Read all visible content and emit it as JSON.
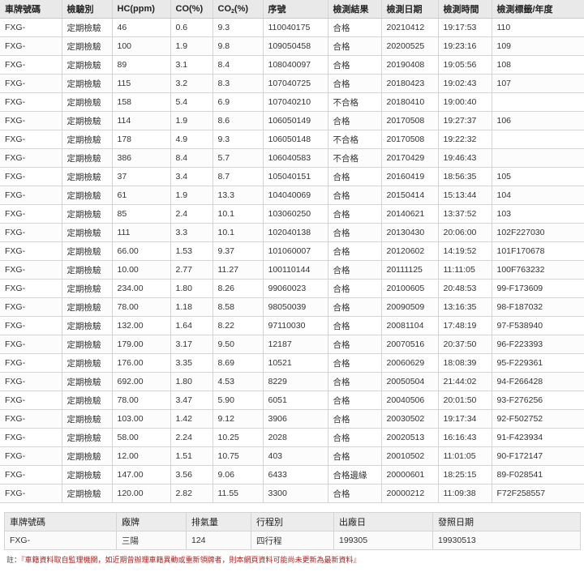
{
  "inspection_table": {
    "headers": {
      "plate": "車牌號碼",
      "category": "檢驗別",
      "hc": "HC(ppm)",
      "co": "CO(%)",
      "co2_prefix": "CO",
      "co2_sub": "2",
      "co2_suffix": "(%)",
      "serial": "序號",
      "result": "檢測結果",
      "date": "檢測日期",
      "time": "檢測時間",
      "label_year": "檢測標籤/年度"
    },
    "rows": [
      {
        "plate": "FXG-",
        "category": "定期檢驗",
        "hc": "46",
        "co": "0.6",
        "co2": "9.3",
        "serial": "110040175",
        "result": "合格",
        "date": "20210412",
        "time": "19:17:53",
        "label": "110"
      },
      {
        "plate": "FXG-",
        "category": "定期檢驗",
        "hc": "100",
        "co": "1.9",
        "co2": "9.8",
        "serial": "109050458",
        "result": "合格",
        "date": "20200525",
        "time": "19:23:16",
        "label": "109"
      },
      {
        "plate": "FXG-",
        "category": "定期檢驗",
        "hc": "89",
        "co": "3.1",
        "co2": "8.4",
        "serial": "108040097",
        "result": "合格",
        "date": "20190408",
        "time": "19:05:56",
        "label": "108"
      },
      {
        "plate": "FXG-",
        "category": "定期檢驗",
        "hc": "115",
        "co": "3.2",
        "co2": "8.3",
        "serial": "107040725",
        "result": "合格",
        "date": "20180423",
        "time": "19:02:43",
        "label": "107"
      },
      {
        "plate": "FXG-",
        "category": "定期檢驗",
        "hc": "158",
        "co": "5.4",
        "co2": "6.9",
        "serial": "107040210",
        "result": "不合格",
        "date": "20180410",
        "time": "19:00:40",
        "label": ""
      },
      {
        "plate": "FXG-",
        "category": "定期檢驗",
        "hc": "114",
        "co": "1.9",
        "co2": "8.6",
        "serial": "106050149",
        "result": "合格",
        "date": "20170508",
        "time": "19:27:37",
        "label": "106"
      },
      {
        "plate": "FXG-",
        "category": "定期檢驗",
        "hc": "178",
        "co": "4.9",
        "co2": "9.3",
        "serial": "106050148",
        "result": "不合格",
        "date": "20170508",
        "time": "19:22:32",
        "label": ""
      },
      {
        "plate": "FXG-",
        "category": "定期檢驗",
        "hc": "386",
        "co": "8.4",
        "co2": "5.7",
        "serial": "106040583",
        "result": "不合格",
        "date": "20170429",
        "time": "19:46:43",
        "label": ""
      },
      {
        "plate": "FXG-",
        "category": "定期檢驗",
        "hc": "37",
        "co": "3.4",
        "co2": "8.7",
        "serial": "105040151",
        "result": "合格",
        "date": "20160419",
        "time": "18:56:35",
        "label": "105"
      },
      {
        "plate": "FXG-",
        "category": "定期檢驗",
        "hc": "61",
        "co": "1.9",
        "co2": "13.3",
        "serial": "104040069",
        "result": "合格",
        "date": "20150414",
        "time": "15:13:44",
        "label": "104"
      },
      {
        "plate": "FXG-",
        "category": "定期檢驗",
        "hc": "85",
        "co": "2.4",
        "co2": "10.1",
        "serial": "103060250",
        "result": "合格",
        "date": "20140621",
        "time": "13:37:52",
        "label": "103"
      },
      {
        "plate": "FXG-",
        "category": "定期檢驗",
        "hc": "111",
        "co": "3.3",
        "co2": "10.1",
        "serial": "102040138",
        "result": "合格",
        "date": "20130430",
        "time": "20:06:00",
        "label": "102F227030"
      },
      {
        "plate": "FXG-",
        "category": "定期檢驗",
        "hc": "66.00",
        "co": "1.53",
        "co2": "9.37",
        "serial": "101060007",
        "result": "合格",
        "date": "20120602",
        "time": "14:19:52",
        "label": "101F170678"
      },
      {
        "plate": "FXG-",
        "category": "定期檢驗",
        "hc": "10.00",
        "co": "2.77",
        "co2": "11.27",
        "serial": "100110144",
        "result": "合格",
        "date": "20111125",
        "time": "11:11:05",
        "label": "100F763232"
      },
      {
        "plate": "FXG-",
        "category": "定期檢驗",
        "hc": "234.00",
        "co": "1.80",
        "co2": "8.26",
        "serial": "99060023",
        "result": "合格",
        "date": "20100605",
        "time": "20:48:53",
        "label": "99-F173609"
      },
      {
        "plate": "FXG-",
        "category": "定期檢驗",
        "hc": "78.00",
        "co": "1.18",
        "co2": "8.58",
        "serial": "98050039",
        "result": "合格",
        "date": "20090509",
        "time": "13:16:35",
        "label": "98-F187032"
      },
      {
        "plate": "FXG-",
        "category": "定期檢驗",
        "hc": "132.00",
        "co": "1.64",
        "co2": "8.22",
        "serial": "97110030",
        "result": "合格",
        "date": "20081104",
        "time": "17:48:19",
        "label": "97-F538940"
      },
      {
        "plate": "FXG-",
        "category": "定期檢驗",
        "hc": "179.00",
        "co": "3.17",
        "co2": "9.50",
        "serial": "12187",
        "result": "合格",
        "date": "20070516",
        "time": "20:37:50",
        "label": "96-F223393"
      },
      {
        "plate": "FXG-",
        "category": "定期檢驗",
        "hc": "176.00",
        "co": "3.35",
        "co2": "8.69",
        "serial": "10521",
        "result": "合格",
        "date": "20060629",
        "time": "18:08:39",
        "label": "95-F229361"
      },
      {
        "plate": "FXG-",
        "category": "定期檢驗",
        "hc": "692.00",
        "co": "1.80",
        "co2": "4.53",
        "serial": "8229",
        "result": "合格",
        "date": "20050504",
        "time": "21:44:02",
        "label": "94-F266428"
      },
      {
        "plate": "FXG-",
        "category": "定期檢驗",
        "hc": "78.00",
        "co": "3.47",
        "co2": "5.90",
        "serial": "6051",
        "result": "合格",
        "date": "20040506",
        "time": "20:01:50",
        "label": "93-F276256"
      },
      {
        "plate": "FXG-",
        "category": "定期檢驗",
        "hc": "103.00",
        "co": "1.42",
        "co2": "9.12",
        "serial": "3906",
        "result": "合格",
        "date": "20030502",
        "time": "19:17:34",
        "label": "92-F502752"
      },
      {
        "plate": "FXG-",
        "category": "定期檢驗",
        "hc": "58.00",
        "co": "2.24",
        "co2": "10.25",
        "serial": "2028",
        "result": "合格",
        "date": "20020513",
        "time": "16:16:43",
        "label": "91-F423934"
      },
      {
        "plate": "FXG-",
        "category": "定期檢驗",
        "hc": "12.00",
        "co": "1.51",
        "co2": "10.75",
        "serial": "403",
        "result": "合格",
        "date": "20010502",
        "time": "11:01:05",
        "label": "90-F172147"
      },
      {
        "plate": "FXG-",
        "category": "定期檢驗",
        "hc": "147.00",
        "co": "3.56",
        "co2": "9.06",
        "serial": "6433",
        "result": "合格邊緣",
        "date": "20000601",
        "time": "18:25:15",
        "label": "89-F028541"
      },
      {
        "plate": "FXG-",
        "category": "定期檢驗",
        "hc": "120.00",
        "co": "2.82",
        "co2": "11.55",
        "serial": "3300",
        "result": "合格",
        "date": "20000212",
        "time": "11:09:38",
        "label": "F72F258557"
      }
    ]
  },
  "vehicle_table": {
    "headers": {
      "plate": "車牌號碼",
      "brand": "廠牌",
      "displacement": "排氣量",
      "stroke": "行程別",
      "manufacture_date": "出廠日",
      "issue_date": "發照日期"
    },
    "row": {
      "plate": "FXG-",
      "brand": "三陽",
      "displacement": "124",
      "stroke": "四行程",
      "manufacture_date": "199305",
      "issue_date": "19930513"
    }
  },
  "note": {
    "prefix": "註：",
    "text": "『車籍資料取自監理機關，如近期曾辦理車籍異動或重新領牌者，則本網頁資料可能尚未更新為最新資料』"
  }
}
